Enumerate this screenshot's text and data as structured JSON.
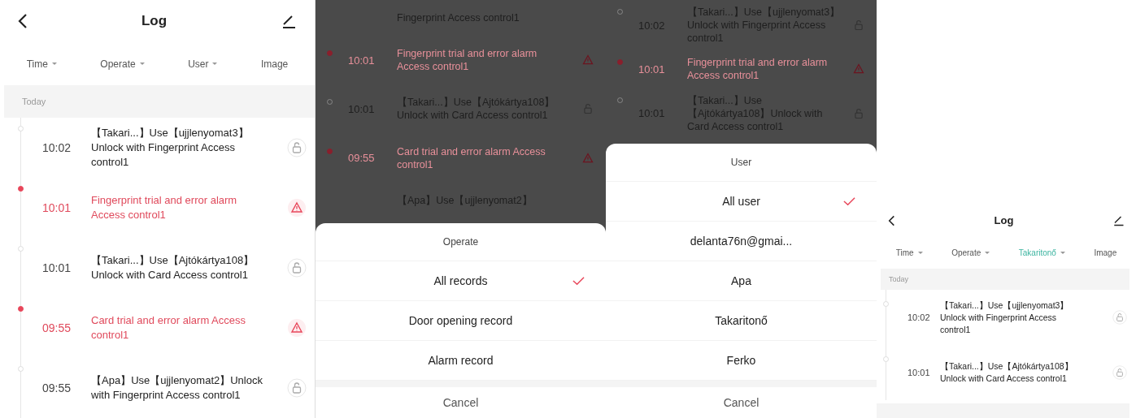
{
  "panels": [
    {
      "kind": "log",
      "header": {
        "title": "Log"
      },
      "filters": [
        {
          "label": "Time",
          "dropdown": true,
          "active": false
        },
        {
          "label": "Operate",
          "dropdown": true,
          "active": false
        },
        {
          "label": "User",
          "dropdown": true,
          "active": false
        },
        {
          "label": "Image",
          "dropdown": false,
          "active": false
        }
      ],
      "section": "Today",
      "entries": [
        {
          "kind": "unlock",
          "time": "10:02",
          "text": "【Takari...】Use【ujjlenyomat3】Unlock with Fingerprint Access control1"
        },
        {
          "kind": "alarm",
          "time": "10:01",
          "text": "Fingerprint trial and error alarm Access control1"
        },
        {
          "kind": "unlock",
          "time": "10:01",
          "text": "【Takari...】Use【Ajtókártya108】Unlock with Card Access control1"
        },
        {
          "kind": "alarm",
          "time": "09:55",
          "text": "Card trial and error alarm Access control1"
        },
        {
          "kind": "unlock",
          "time": "09:55",
          "text": "【Apa】Use【ujjlenyomat2】Unlock with Fingerprint Access control1"
        }
      ]
    },
    {
      "kind": "sheet",
      "background": [
        {
          "kind": "partial",
          "text": "Fingerprint Access control1"
        },
        {
          "kind": "alarm",
          "time": "10:01",
          "text": "Fingerprint trial and error alarm Access control1"
        },
        {
          "kind": "unlock",
          "time": "10:01",
          "text": "【Takari...】Use【Ajtókártya108】Unlock with Card Access control1"
        },
        {
          "kind": "alarm",
          "time": "09:55",
          "text": "Card trial and error alarm Access control1"
        },
        {
          "kind": "partial",
          "text": "【Apa】Use【ujjlenyomat2】"
        }
      ],
      "sheet": {
        "title": "Operate",
        "options": [
          {
            "label": "All records",
            "selected": true
          },
          {
            "label": "Door opening record",
            "selected": false
          },
          {
            "label": "Alarm record",
            "selected": false
          }
        ],
        "cancel": "Cancel"
      }
    },
    {
      "kind": "sheet",
      "background": [
        {
          "kind": "unlock",
          "time": "10:02",
          "text": "【Takari...】Use【ujjlenyomat3】Unlock with Fingerprint Access control1"
        },
        {
          "kind": "alarm",
          "time": "10:01",
          "text": "Fingerprint trial and error alarm Access control1"
        },
        {
          "kind": "unlock",
          "time": "10:01",
          "text": "【Takari...】Use【Ajtókártya108】Unlock with Card Access control1"
        }
      ],
      "sheet": {
        "title": "User",
        "options": [
          {
            "label": "All user",
            "selected": true
          },
          {
            "label": "delanta76n@gmai...",
            "selected": false
          },
          {
            "label": "Apa",
            "selected": false
          },
          {
            "label": "Takaritonő",
            "selected": false
          },
          {
            "label": "Ferko",
            "selected": false
          }
        ],
        "cancel": "Cancel"
      }
    },
    {
      "kind": "log",
      "header": {
        "title": "Log"
      },
      "filters": [
        {
          "label": "Time",
          "dropdown": true,
          "active": false
        },
        {
          "label": "Operate",
          "dropdown": true,
          "active": false
        },
        {
          "label": "Takaritonő",
          "dropdown": true,
          "active": true
        },
        {
          "label": "Image",
          "dropdown": false,
          "active": false
        }
      ],
      "section": "Today",
      "entries": [
        {
          "kind": "unlock",
          "time": "10:02",
          "text": "【Takari...】Use【ujjlenyomat3】Unlock with Fingerprint Access control1"
        },
        {
          "kind": "unlock",
          "time": "10:01",
          "text": "【Takari...】Use【Ajtókártya108】Unlock with Card Access control1"
        }
      ]
    }
  ]
}
